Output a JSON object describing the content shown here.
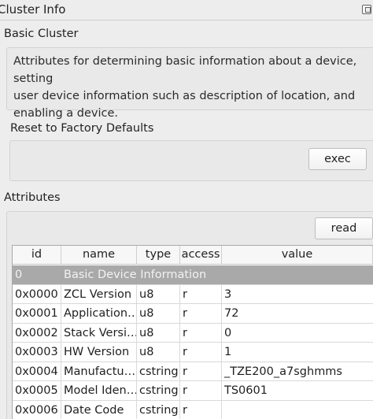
{
  "window": {
    "title": "Cluster Info"
  },
  "basic": {
    "title": "Basic Cluster",
    "description_lines": [
      "Attributes for determining basic information about a device, setting",
      "user device information such as description of location, and",
      "enabling a device."
    ]
  },
  "reset": {
    "title": "Reset to Factory Defaults",
    "button_label": "exec"
  },
  "attributes": {
    "title": "Attributes",
    "read_button_label": "read",
    "columns": [
      "id",
      "name",
      "type",
      "access",
      "value"
    ],
    "group_row": {
      "id": "0",
      "name": "Basic Device Information"
    },
    "rows": [
      {
        "id": "0x0000",
        "name": "ZCL Version",
        "type": "u8",
        "access": "r",
        "value": "3"
      },
      {
        "id": "0x0001",
        "name": "Application…",
        "type": "u8",
        "access": "r",
        "value": "72"
      },
      {
        "id": "0x0002",
        "name": "Stack Versi…",
        "type": "u8",
        "access": "r",
        "value": "0"
      },
      {
        "id": "0x0003",
        "name": "HW Version",
        "type": "u8",
        "access": "r",
        "value": "1"
      },
      {
        "id": "0x0004",
        "name": "Manufactu…",
        "type": "cstring",
        "access": "r",
        "value": "_TZE200_a7sghmms"
      },
      {
        "id": "0x0005",
        "name": "Model Iden…",
        "type": "cstring",
        "access": "r",
        "value": "TS0601"
      },
      {
        "id": "0x0006",
        "name": "Date Code",
        "type": "cstring",
        "access": "r",
        "value": ""
      }
    ]
  },
  "icons": {
    "float_button": "float-window-icon",
    "scroll_up": "arrow-up-icon"
  }
}
